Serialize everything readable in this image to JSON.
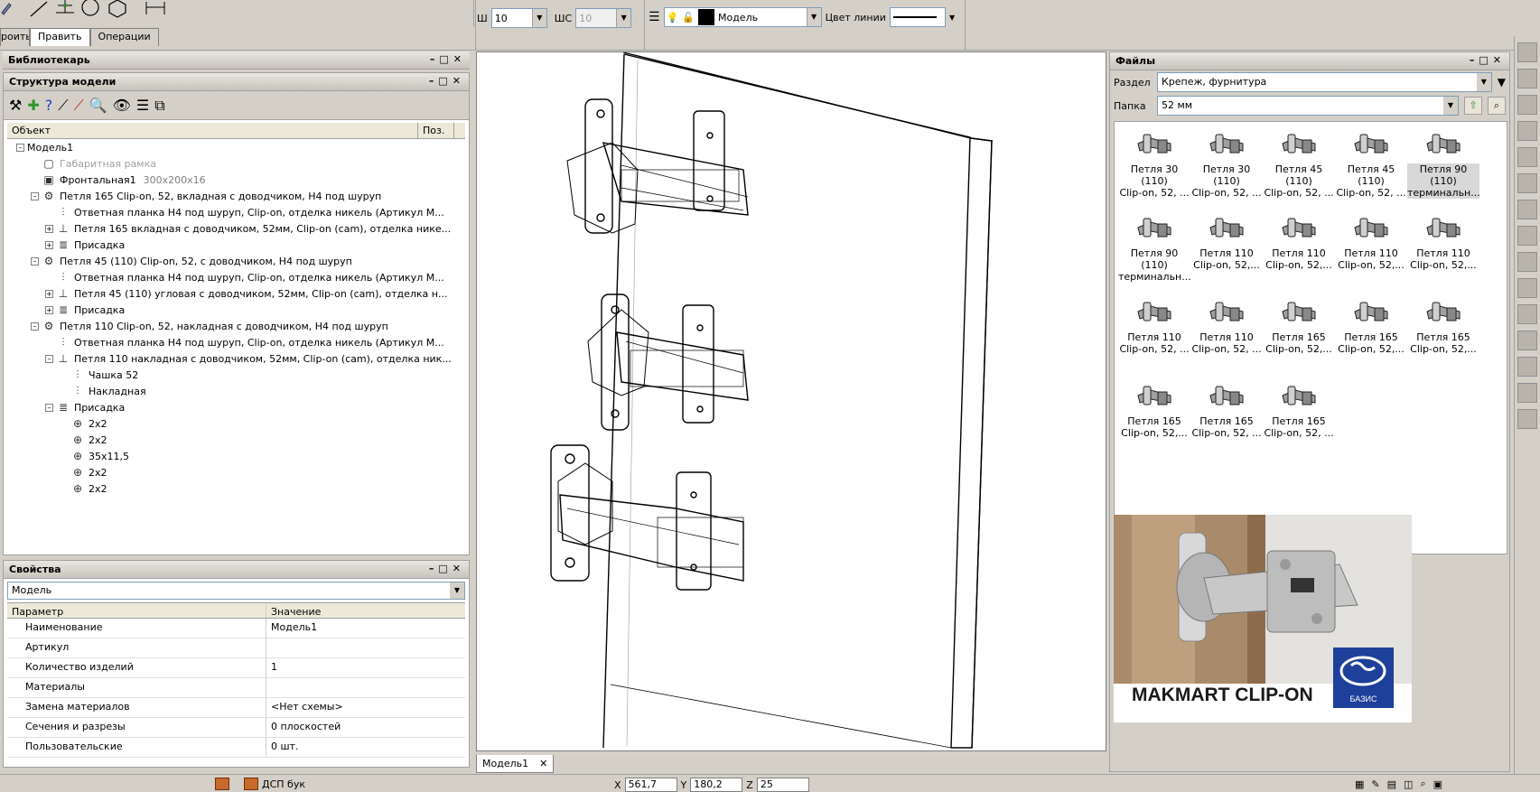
{
  "toolbar": {
    "tabs": [
      {
        "label": "роить"
      },
      {
        "label": "Править"
      },
      {
        "label": "Операции"
      }
    ],
    "w_label": "Ш",
    "w_value": "10",
    "ws_label": "ШС",
    "ws_value": "10",
    "layer_name": "Модель",
    "line_color_label": "Цвет линии"
  },
  "librarian": {
    "title": "Библиотекарь"
  },
  "structure": {
    "title": "Структура модели",
    "col_object": "Объект",
    "col_pos": "Поз.",
    "rows": [
      {
        "label": "Модель1",
        "dim": ""
      },
      {
        "label": "Габаритная рамка",
        "dim": ""
      },
      {
        "label": "Фронтальная1",
        "dim": "300x200x16"
      },
      {
        "label": "Петля 165 Clip-on, 52, вкладная с доводчиком, H4 под шуруп",
        "dim": ""
      },
      {
        "label": "Ответная планка H4 под шуруп, Clip-on, отделка никель (Артикул М...",
        "dim": ""
      },
      {
        "label": "Петля 165 вкладная с доводчиком, 52мм, Clip-on (cam), отделка нике...",
        "dim": ""
      },
      {
        "label": "Присадка",
        "dim": ""
      },
      {
        "label": "Петля 45 (110) Clip-on, 52, с доводчиком, H4 под шуруп",
        "dim": ""
      },
      {
        "label": "Ответная планка H4 под шуруп, Clip-on, отделка никель (Артикул М...",
        "dim": ""
      },
      {
        "label": "Петля 45 (110) угловая с доводчиком, 52мм, Clip-on (cam), отделка н...",
        "dim": ""
      },
      {
        "label": "Присадка",
        "dim": ""
      },
      {
        "label": "Петля 110 Clip-on, 52, накладная с доводчиком, H4 под шуруп",
        "dim": ""
      },
      {
        "label": "Ответная планка H4 под шуруп, Clip-on, отделка никель (Артикул М...",
        "dim": ""
      },
      {
        "label": "Петля 110 накладная с доводчиком, 52мм, Clip-on (cam), отделка ник...",
        "dim": ""
      },
      {
        "label": "Чашка 52",
        "dim": ""
      },
      {
        "label": "Накладная",
        "dim": ""
      },
      {
        "label": "Присадка",
        "dim": ""
      },
      {
        "label": "2x2",
        "dim": ""
      },
      {
        "label": "2x2",
        "dim": ""
      },
      {
        "label": "35x11,5",
        "dim": ""
      },
      {
        "label": "2x2",
        "dim": ""
      },
      {
        "label": "2x2",
        "dim": ""
      }
    ]
  },
  "properties": {
    "title": "Свойства",
    "selector": "Модель",
    "col_param": "Параметр",
    "col_value": "Значение",
    "rows": [
      {
        "name": "Наименование",
        "value": "Модель1"
      },
      {
        "name": "Артикул",
        "value": ""
      },
      {
        "name": "Количество изделий",
        "value": "1"
      },
      {
        "name": "Материалы",
        "value": ""
      },
      {
        "name": "Замена материалов",
        "value": "<Нет схемы>"
      },
      {
        "name": "Сечения и разрезы",
        "value": "0 плоскостей"
      },
      {
        "name": "Пользовательские",
        "value": "0 шт."
      }
    ]
  },
  "viewport": {
    "tab": "Модель1"
  },
  "files": {
    "title": "Файлы",
    "section_label": "Раздел",
    "section_value": "Крепеж, фурнитура",
    "folder_label": "Папка",
    "folder_value": "52 мм",
    "items": [
      {
        "l1": "Петля 30 (110)",
        "l2": "Clip-on, 52, ..."
      },
      {
        "l1": "Петля 30 (110)",
        "l2": "Clip-on, 52, ..."
      },
      {
        "l1": "Петля 45 (110)",
        "l2": "Clip-on, 52, ..."
      },
      {
        "l1": "Петля 45 (110)",
        "l2": "Clip-on, 52, ..."
      },
      {
        "l1": "Петля 90 (110)",
        "l2": "терминальн..."
      },
      {
        "l1": "Петля 90 (110)",
        "l2": "терминальн..."
      },
      {
        "l1": "Петля 110",
        "l2": "Clip-on, 52,..."
      },
      {
        "l1": "Петля 110",
        "l2": "Clip-on, 52,..."
      },
      {
        "l1": "Петля 110",
        "l2": "Clip-on, 52,..."
      },
      {
        "l1": "Петля 110",
        "l2": "Clip-on, 52,..."
      },
      {
        "l1": "Петля 110",
        "l2": "Clip-on, 52, ..."
      },
      {
        "l1": "Петля 110",
        "l2": "Clip-on, 52, ..."
      },
      {
        "l1": "Петля 165",
        "l2": "Clip-on, 52,..."
      },
      {
        "l1": "Петля 165",
        "l2": "Clip-on, 52,..."
      },
      {
        "l1": "Петля 165",
        "l2": "Clip-on, 52,..."
      },
      {
        "l1": "Петля 165",
        "l2": "Clip-on, 52,..."
      },
      {
        "l1": "Петля 165",
        "l2": "Clip-on, 52, ..."
      },
      {
        "l1": "Петля 165",
        "l2": "Clip-on, 52, ..."
      }
    ]
  },
  "promo": {
    "text": "MAKMART CLIP-ON",
    "logo_text": "БАЗИС"
  },
  "statusbar": {
    "material": "ДСП бук",
    "x_label": "X",
    "x_value": "561,7",
    "y_label": "Y",
    "y_value": "180,2",
    "z_label": "Z",
    "z_value": "25"
  },
  "colors": {
    "accent_blue": "#1e3f9a",
    "panel_bg": "#d4d0c8"
  }
}
